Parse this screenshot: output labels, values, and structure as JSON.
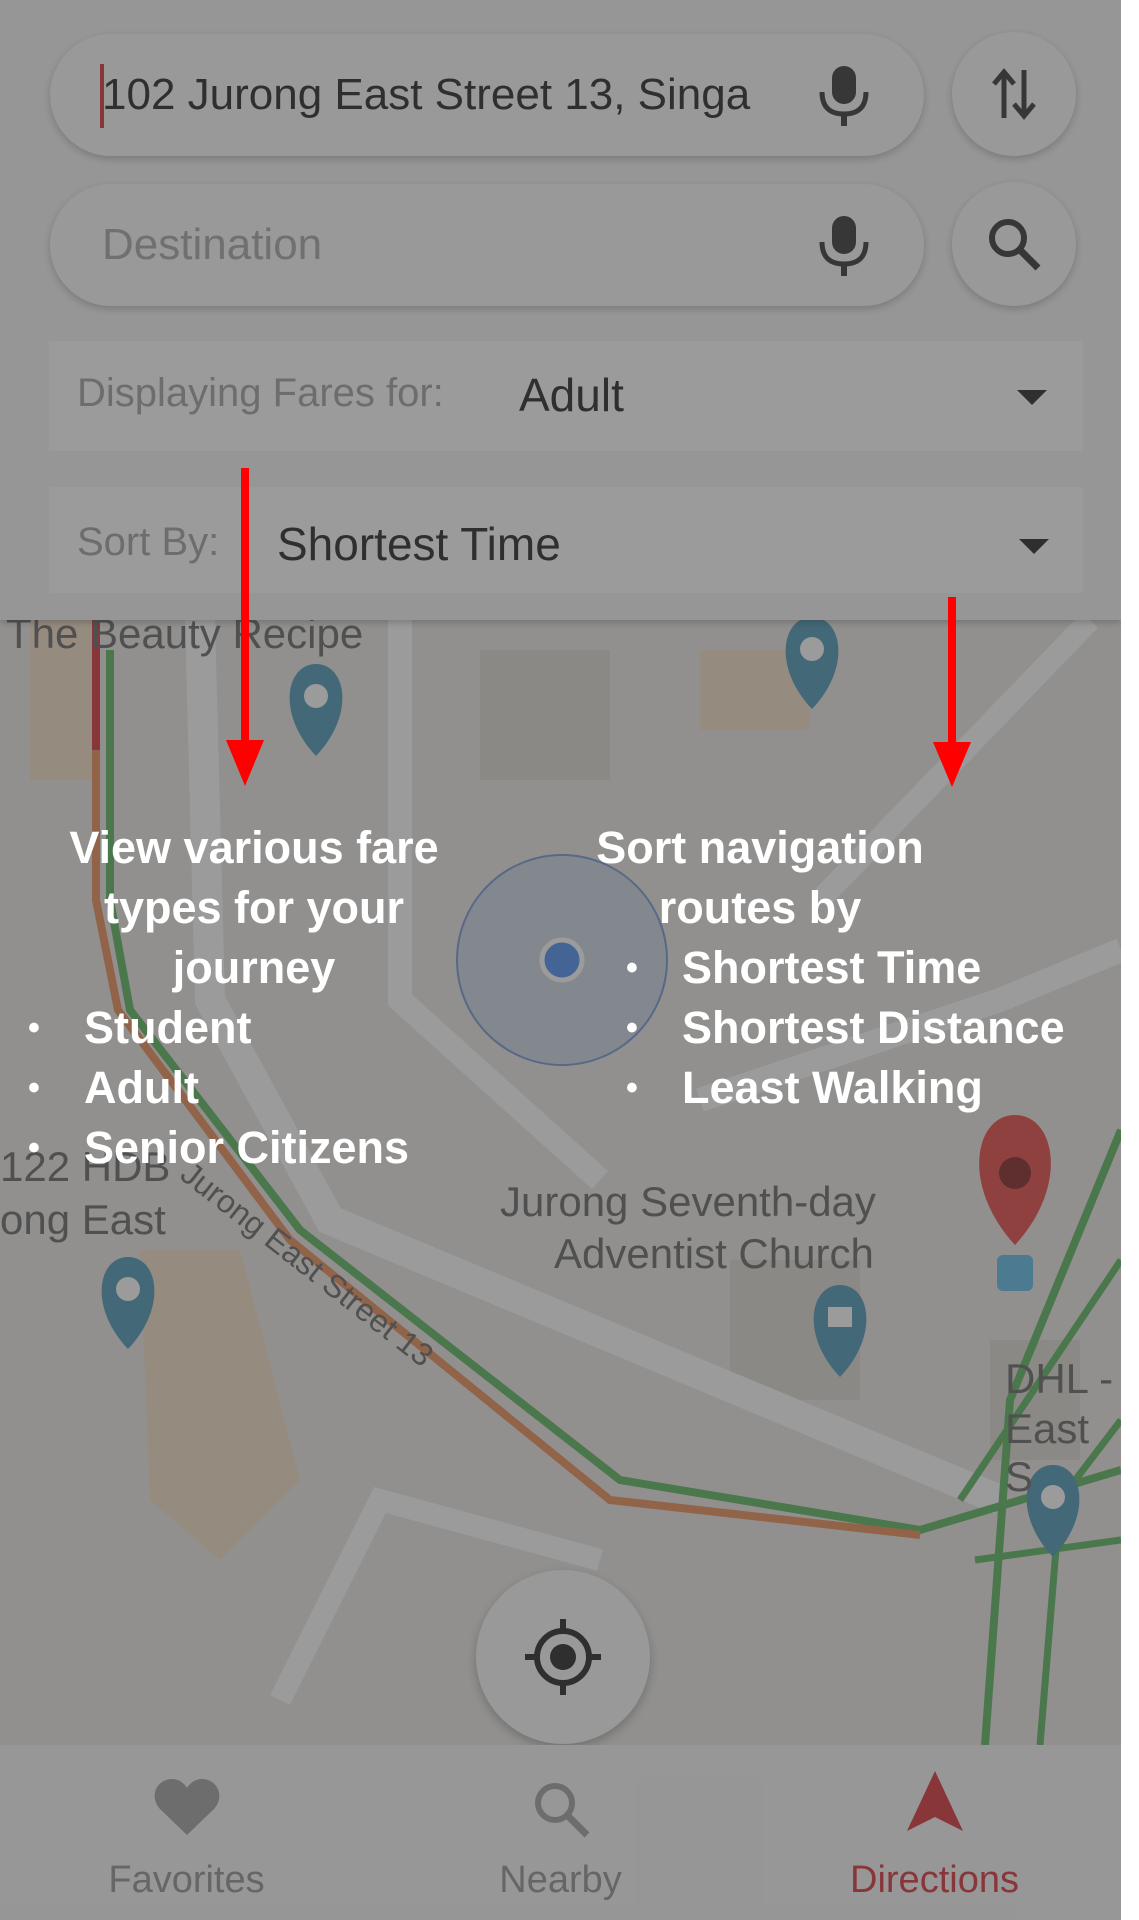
{
  "search": {
    "origin_value": "102 Jurong East Street 13, Singa",
    "destination_placeholder": "Destination"
  },
  "fares": {
    "label": "Displaying Fares for:",
    "value": "Adult"
  },
  "sort": {
    "label": "Sort By:",
    "value": "Shortest Time"
  },
  "map_labels": {
    "beauty": "The Beauty Recipe",
    "hdb_line1": "122 HDB",
    "hdb_line2": "ong East",
    "street": "Jurong East Street 13",
    "church_line1": "Jurong Seventh-day",
    "church_line2": "Adventist Church",
    "dhl_line1": "DHL -",
    "dhl_line2": "East S"
  },
  "callouts": {
    "fares": {
      "title_lines": [
        "View various fare",
        "types for your",
        "journey"
      ],
      "items": [
        "Student",
        "Adult",
        "Senior Citizens"
      ]
    },
    "sort": {
      "title_lines": [
        "Sort navigation",
        "routes by"
      ],
      "items": [
        "Shortest Time",
        "Shortest Distance",
        "Least Walking"
      ]
    }
  },
  "nav": {
    "items": [
      {
        "label": "Favorites",
        "icon": "heart-icon",
        "active": false
      },
      {
        "label": "Nearby",
        "icon": "search-icon",
        "active": false
      },
      {
        "label": "Directions",
        "icon": "navigation-arrow-icon",
        "active": true
      }
    ]
  },
  "colors": {
    "accent_red": "#d42027",
    "annotation_red": "#ff0000",
    "route_green": "#4caf50",
    "route_orange": "#e8834a",
    "location_blue": "#4285f4"
  }
}
